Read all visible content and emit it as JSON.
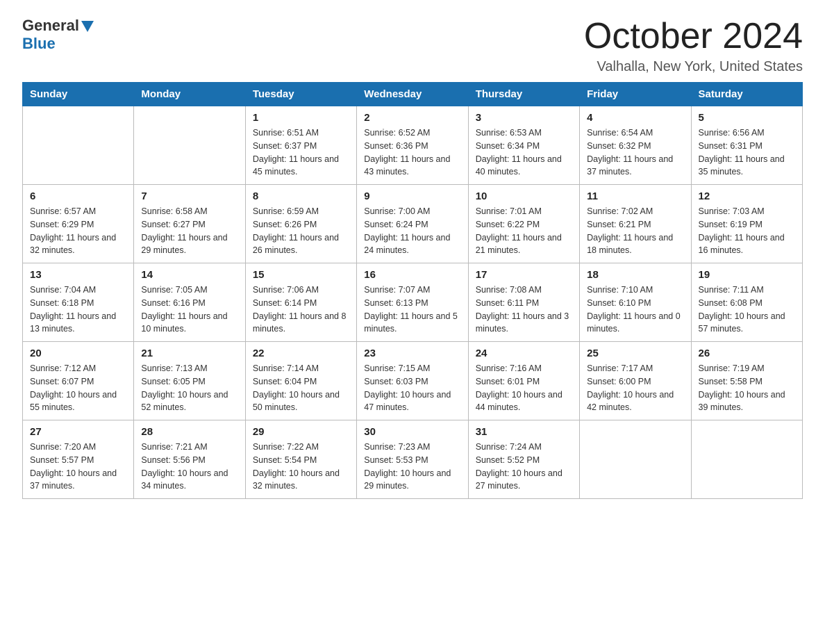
{
  "logo": {
    "general": "General",
    "blue": "Blue"
  },
  "title": "October 2024",
  "subtitle": "Valhalla, New York, United States",
  "weekdays": [
    "Sunday",
    "Monday",
    "Tuesday",
    "Wednesday",
    "Thursday",
    "Friday",
    "Saturday"
  ],
  "weeks": [
    [
      {
        "day": "",
        "sunrise": "",
        "sunset": "",
        "daylight": ""
      },
      {
        "day": "",
        "sunrise": "",
        "sunset": "",
        "daylight": ""
      },
      {
        "day": "1",
        "sunrise": "Sunrise: 6:51 AM",
        "sunset": "Sunset: 6:37 PM",
        "daylight": "Daylight: 11 hours and 45 minutes."
      },
      {
        "day": "2",
        "sunrise": "Sunrise: 6:52 AM",
        "sunset": "Sunset: 6:36 PM",
        "daylight": "Daylight: 11 hours and 43 minutes."
      },
      {
        "day": "3",
        "sunrise": "Sunrise: 6:53 AM",
        "sunset": "Sunset: 6:34 PM",
        "daylight": "Daylight: 11 hours and 40 minutes."
      },
      {
        "day": "4",
        "sunrise": "Sunrise: 6:54 AM",
        "sunset": "Sunset: 6:32 PM",
        "daylight": "Daylight: 11 hours and 37 minutes."
      },
      {
        "day": "5",
        "sunrise": "Sunrise: 6:56 AM",
        "sunset": "Sunset: 6:31 PM",
        "daylight": "Daylight: 11 hours and 35 minutes."
      }
    ],
    [
      {
        "day": "6",
        "sunrise": "Sunrise: 6:57 AM",
        "sunset": "Sunset: 6:29 PM",
        "daylight": "Daylight: 11 hours and 32 minutes."
      },
      {
        "day": "7",
        "sunrise": "Sunrise: 6:58 AM",
        "sunset": "Sunset: 6:27 PM",
        "daylight": "Daylight: 11 hours and 29 minutes."
      },
      {
        "day": "8",
        "sunrise": "Sunrise: 6:59 AM",
        "sunset": "Sunset: 6:26 PM",
        "daylight": "Daylight: 11 hours and 26 minutes."
      },
      {
        "day": "9",
        "sunrise": "Sunrise: 7:00 AM",
        "sunset": "Sunset: 6:24 PM",
        "daylight": "Daylight: 11 hours and 24 minutes."
      },
      {
        "day": "10",
        "sunrise": "Sunrise: 7:01 AM",
        "sunset": "Sunset: 6:22 PM",
        "daylight": "Daylight: 11 hours and 21 minutes."
      },
      {
        "day": "11",
        "sunrise": "Sunrise: 7:02 AM",
        "sunset": "Sunset: 6:21 PM",
        "daylight": "Daylight: 11 hours and 18 minutes."
      },
      {
        "day": "12",
        "sunrise": "Sunrise: 7:03 AM",
        "sunset": "Sunset: 6:19 PM",
        "daylight": "Daylight: 11 hours and 16 minutes."
      }
    ],
    [
      {
        "day": "13",
        "sunrise": "Sunrise: 7:04 AM",
        "sunset": "Sunset: 6:18 PM",
        "daylight": "Daylight: 11 hours and 13 minutes."
      },
      {
        "day": "14",
        "sunrise": "Sunrise: 7:05 AM",
        "sunset": "Sunset: 6:16 PM",
        "daylight": "Daylight: 11 hours and 10 minutes."
      },
      {
        "day": "15",
        "sunrise": "Sunrise: 7:06 AM",
        "sunset": "Sunset: 6:14 PM",
        "daylight": "Daylight: 11 hours and 8 minutes."
      },
      {
        "day": "16",
        "sunrise": "Sunrise: 7:07 AM",
        "sunset": "Sunset: 6:13 PM",
        "daylight": "Daylight: 11 hours and 5 minutes."
      },
      {
        "day": "17",
        "sunrise": "Sunrise: 7:08 AM",
        "sunset": "Sunset: 6:11 PM",
        "daylight": "Daylight: 11 hours and 3 minutes."
      },
      {
        "day": "18",
        "sunrise": "Sunrise: 7:10 AM",
        "sunset": "Sunset: 6:10 PM",
        "daylight": "Daylight: 11 hours and 0 minutes."
      },
      {
        "day": "19",
        "sunrise": "Sunrise: 7:11 AM",
        "sunset": "Sunset: 6:08 PM",
        "daylight": "Daylight: 10 hours and 57 minutes."
      }
    ],
    [
      {
        "day": "20",
        "sunrise": "Sunrise: 7:12 AM",
        "sunset": "Sunset: 6:07 PM",
        "daylight": "Daylight: 10 hours and 55 minutes."
      },
      {
        "day": "21",
        "sunrise": "Sunrise: 7:13 AM",
        "sunset": "Sunset: 6:05 PM",
        "daylight": "Daylight: 10 hours and 52 minutes."
      },
      {
        "day": "22",
        "sunrise": "Sunrise: 7:14 AM",
        "sunset": "Sunset: 6:04 PM",
        "daylight": "Daylight: 10 hours and 50 minutes."
      },
      {
        "day": "23",
        "sunrise": "Sunrise: 7:15 AM",
        "sunset": "Sunset: 6:03 PM",
        "daylight": "Daylight: 10 hours and 47 minutes."
      },
      {
        "day": "24",
        "sunrise": "Sunrise: 7:16 AM",
        "sunset": "Sunset: 6:01 PM",
        "daylight": "Daylight: 10 hours and 44 minutes."
      },
      {
        "day": "25",
        "sunrise": "Sunrise: 7:17 AM",
        "sunset": "Sunset: 6:00 PM",
        "daylight": "Daylight: 10 hours and 42 minutes."
      },
      {
        "day": "26",
        "sunrise": "Sunrise: 7:19 AM",
        "sunset": "Sunset: 5:58 PM",
        "daylight": "Daylight: 10 hours and 39 minutes."
      }
    ],
    [
      {
        "day": "27",
        "sunrise": "Sunrise: 7:20 AM",
        "sunset": "Sunset: 5:57 PM",
        "daylight": "Daylight: 10 hours and 37 minutes."
      },
      {
        "day": "28",
        "sunrise": "Sunrise: 7:21 AM",
        "sunset": "Sunset: 5:56 PM",
        "daylight": "Daylight: 10 hours and 34 minutes."
      },
      {
        "day": "29",
        "sunrise": "Sunrise: 7:22 AM",
        "sunset": "Sunset: 5:54 PM",
        "daylight": "Daylight: 10 hours and 32 minutes."
      },
      {
        "day": "30",
        "sunrise": "Sunrise: 7:23 AM",
        "sunset": "Sunset: 5:53 PM",
        "daylight": "Daylight: 10 hours and 29 minutes."
      },
      {
        "day": "31",
        "sunrise": "Sunrise: 7:24 AM",
        "sunset": "Sunset: 5:52 PM",
        "daylight": "Daylight: 10 hours and 27 minutes."
      },
      {
        "day": "",
        "sunrise": "",
        "sunset": "",
        "daylight": ""
      },
      {
        "day": "",
        "sunrise": "",
        "sunset": "",
        "daylight": ""
      }
    ]
  ]
}
